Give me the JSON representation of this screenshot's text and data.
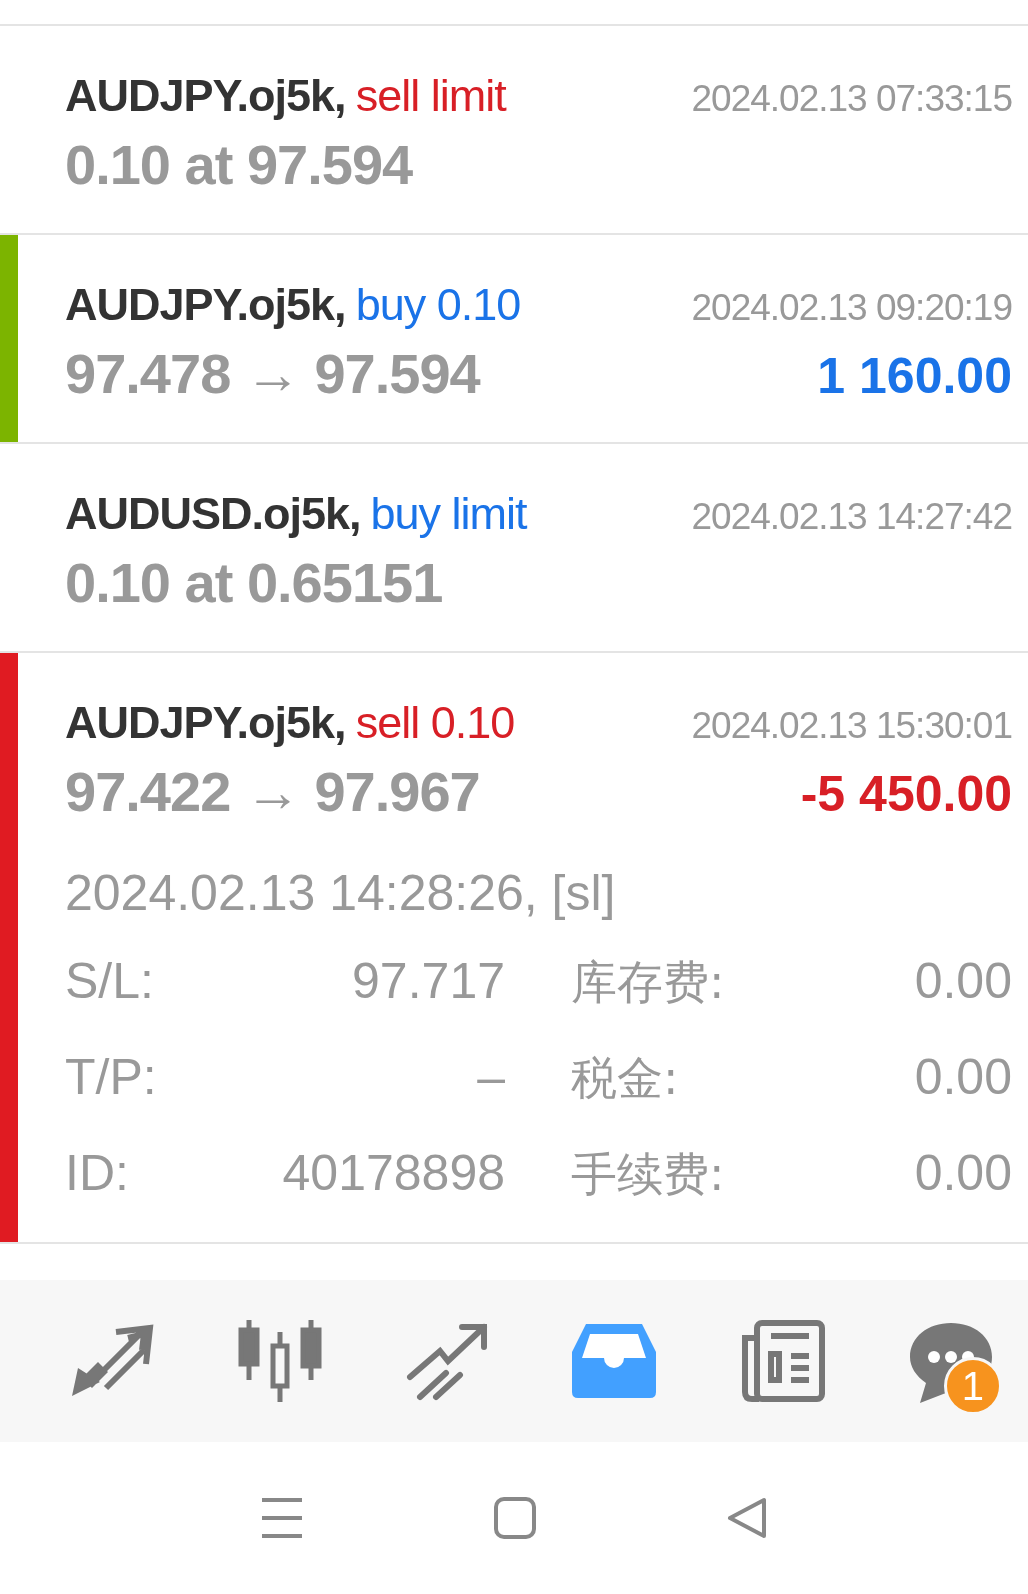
{
  "trades": [
    {
      "kind": "order",
      "color": "#d81f26",
      "symbol": "AUDJPY.oj5k,",
      "type": "sell limit",
      "time": "2024.02.13 07:33:15",
      "detail": "0.10 at 97.594"
    },
    {
      "kind": "position",
      "color": "#1a73e8",
      "strip": {
        "color": "#7cb400"
      },
      "symbol": "AUDJPY.oj5k,",
      "type": "buy 0.10",
      "time": "2024.02.13 09:20:19",
      "detail": "97.478 → 97.594",
      "profit": "1 160.00",
      "loss": false
    },
    {
      "kind": "order",
      "color": "#1a73e8",
      "symbol": "AUDUSD.oj5k,",
      "type": "buy limit",
      "time": "2024.02.13 14:27:42",
      "detail": "0.10 at 0.65151"
    },
    {
      "kind": "position",
      "color": "#d81f26",
      "strip": {
        "color": "#e01b22"
      },
      "symbol": "AUDJPY.oj5k,",
      "type": "sell 0.10",
      "time": "2024.02.13 15:30:01",
      "detail": "97.422 → 97.967",
      "profit": "-5 450.00",
      "loss": true,
      "expanded_info": {
        "open_time": "2024.02.13 14:28:26, [sl]",
        "fields": [
          {
            "label": "S/L:",
            "value": "97.717",
            "label2": "库存费:",
            "value2": "0.00"
          },
          {
            "label": "T/P:",
            "value": "–",
            "label2": "税金:",
            "value2": "0.00"
          },
          {
            "label": "ID:",
            "value": "40178898",
            "label2": "手续费:",
            "value2": "0.00"
          }
        ]
      }
    }
  ],
  "tabs": [
    {
      "selected": false
    },
    {
      "selected": false
    },
    {
      "selected": false
    },
    {
      "selected": true
    },
    {
      "selected": false
    },
    {
      "selected": false,
      "badge": "1"
    }
  ]
}
